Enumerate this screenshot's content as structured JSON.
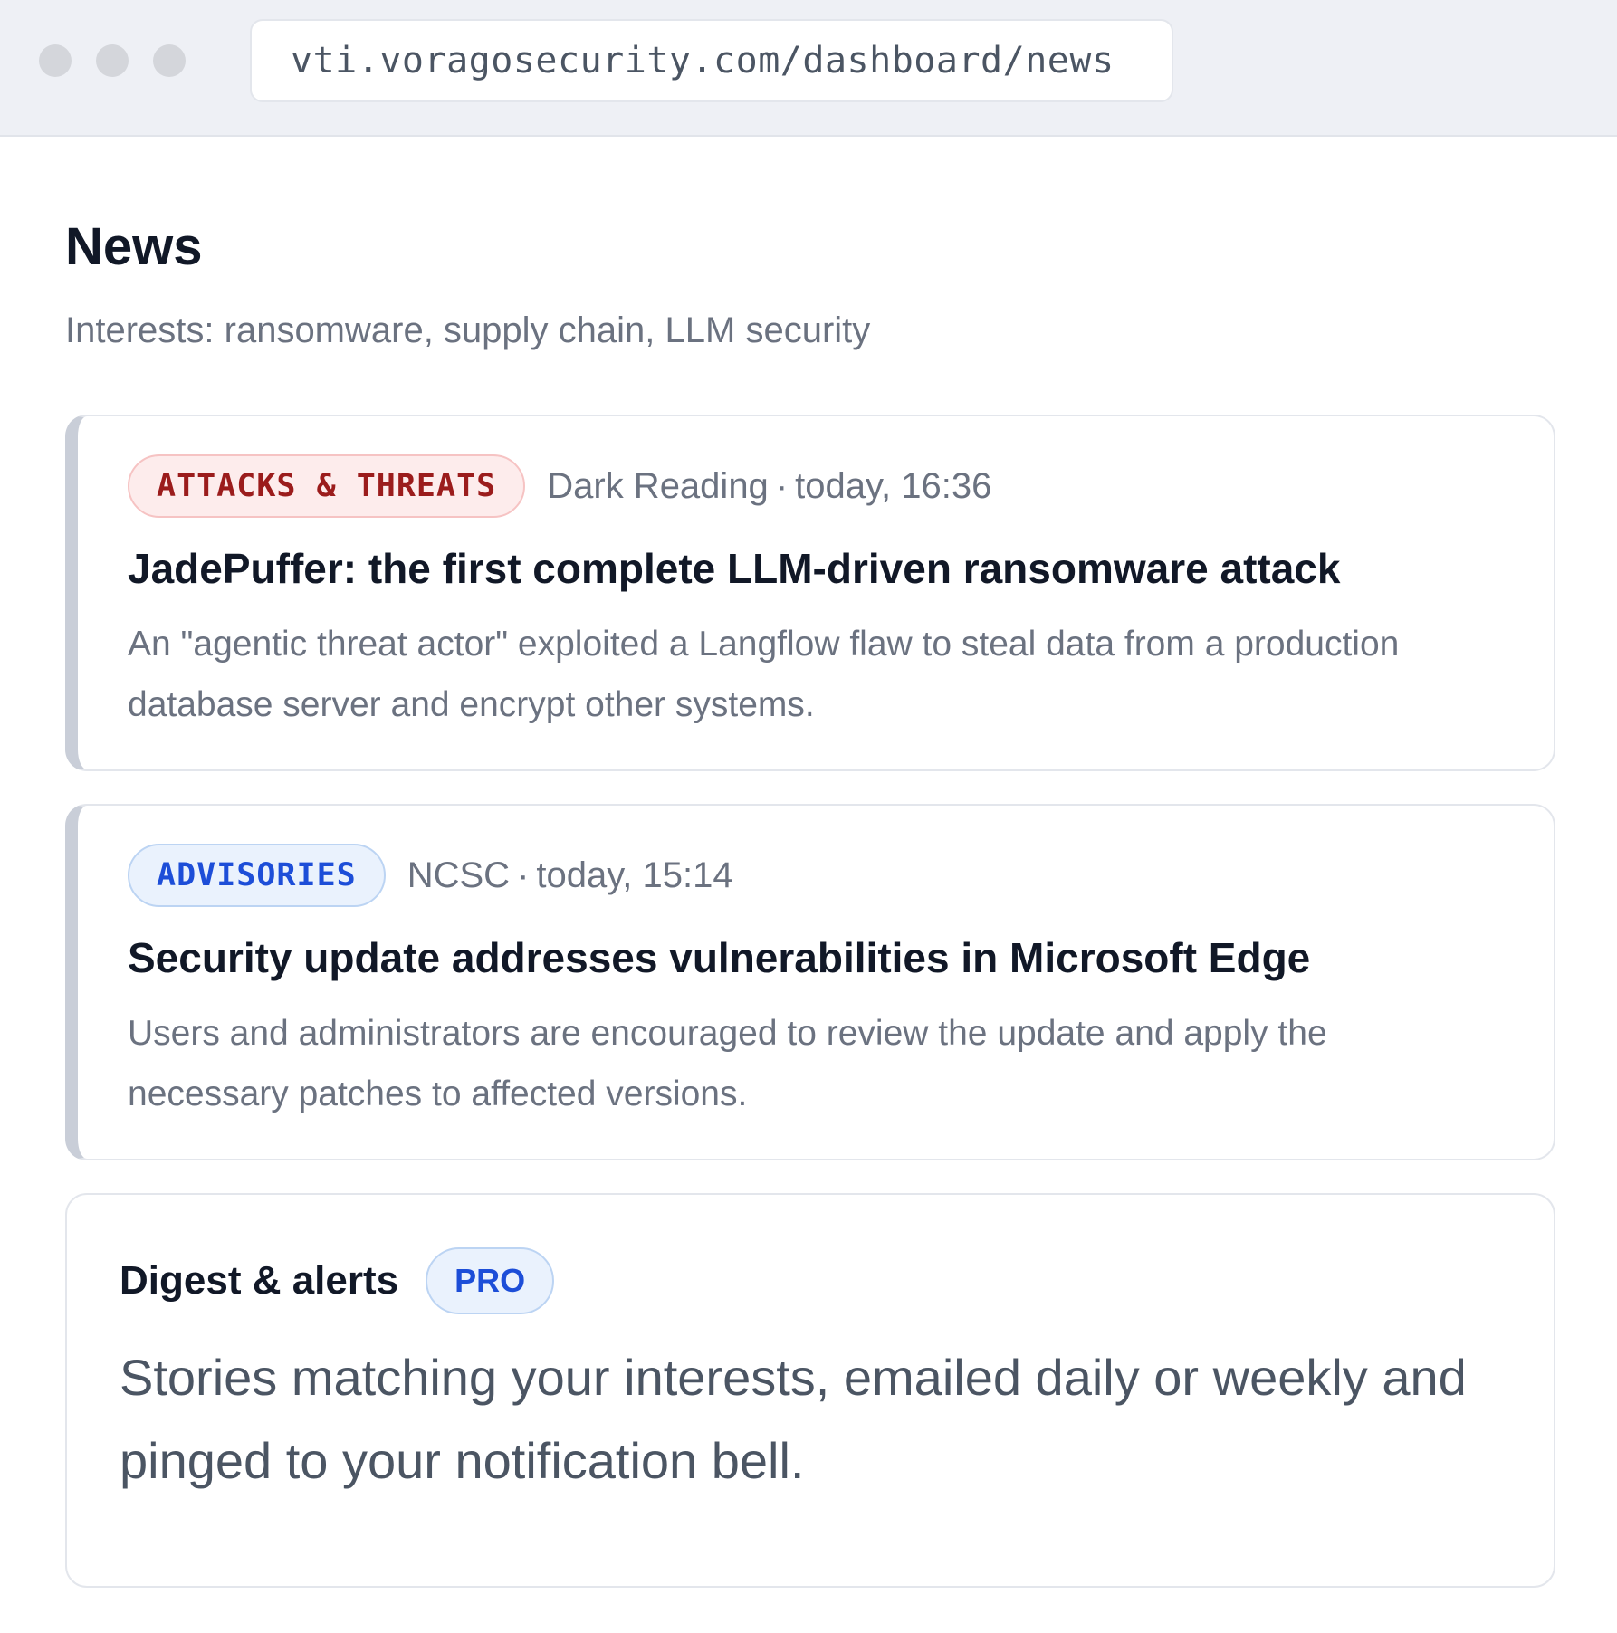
{
  "browser": {
    "url": "vti.voragosecurity.com/dashboard/news"
  },
  "page": {
    "title": "News",
    "interests": "Interests: ransomware, supply chain, LLM security"
  },
  "news": [
    {
      "category": "ATTACKS & THREATS",
      "source": "Dark Reading",
      "separator": "·",
      "time": "today, 16:36",
      "title": "JadePuffer: the first complete LLM-driven ransomware attack",
      "description": "An \"agentic threat actor\" exploited a Langflow flaw to steal data from a production database server and encrypt other systems."
    },
    {
      "category": "ADVISORIES",
      "source": "NCSC",
      "separator": "·",
      "time": "today, 15:14",
      "title": "Security update addresses vulnerabilities in Microsoft Edge",
      "description": "Users and administrators are encouraged to review the update and apply the necessary patches to affected versions."
    }
  ],
  "digest": {
    "title": "Digest & alerts",
    "badge": "PRO",
    "body": "Stories matching your interests, emailed daily or weekly and pinged to your notification bell."
  },
  "colors": {
    "threat_tag": "#9b1c1c",
    "advisory_tag": "#1d4ed8",
    "pro_badge": "#1d4ed8",
    "card_accent": "#c9ced8"
  }
}
